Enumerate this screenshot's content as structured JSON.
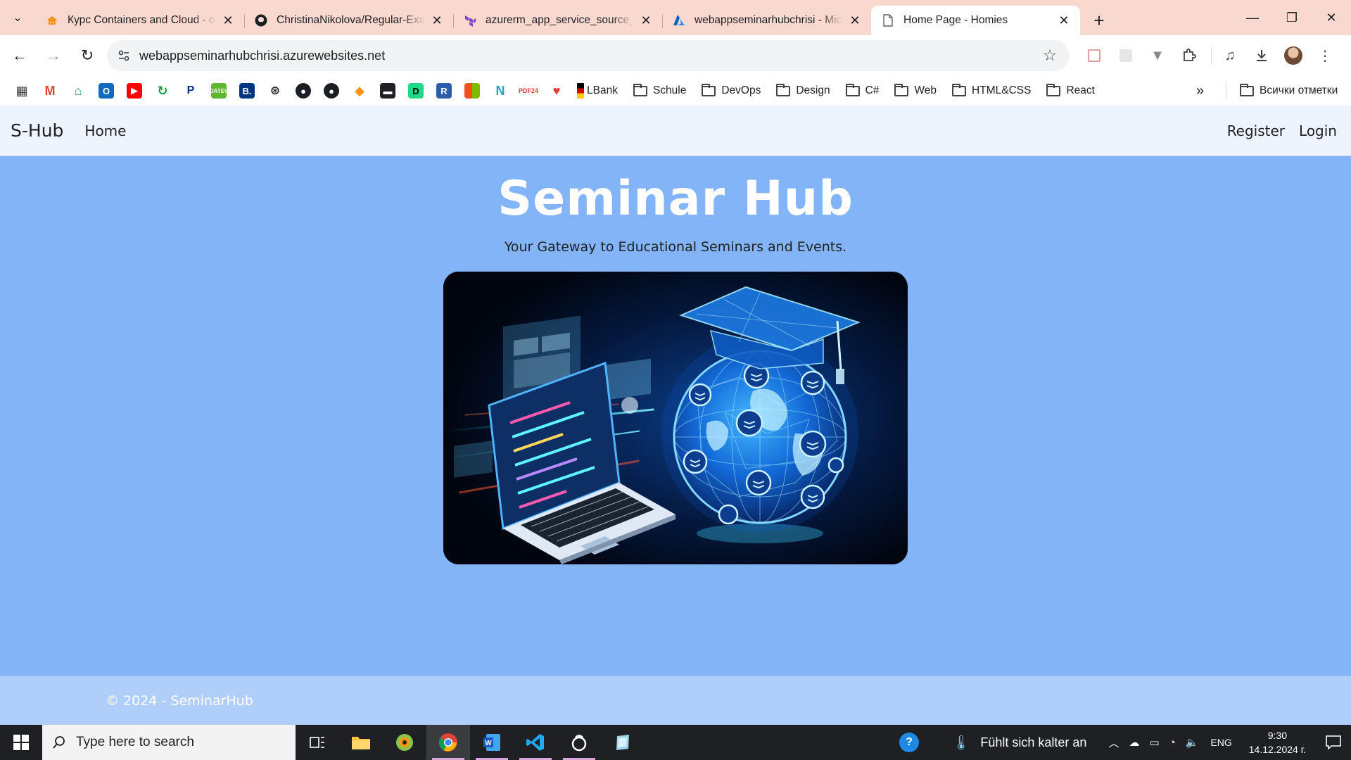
{
  "browser": {
    "tabs": [
      {
        "title": "Курс Containers and Cloud - ok",
        "icon": "moodle-icon"
      },
      {
        "title": "ChristinaNikolova/Regular-Exam",
        "icon": "github-icon"
      },
      {
        "title": "azurerm_app_service_source_co",
        "icon": "terraform-icon"
      },
      {
        "title": "webappseminarhubchrisi - Micr",
        "icon": "azure-icon"
      },
      {
        "title": "Home Page - Homies",
        "icon": "document-icon",
        "active": true
      }
    ],
    "url": "webappseminarhubchrisi.azurewebsites.net",
    "bookmark_folders": [
      "LBank",
      "Schule",
      "DevOps",
      "Design",
      "C#",
      "Web",
      "HTML&CSS",
      "React"
    ],
    "all_bookmarks_label": "Всички отметки"
  },
  "site": {
    "brand": "S-Hub",
    "nav": {
      "home": "Home",
      "register": "Register",
      "login": "Login"
    },
    "hero": {
      "title": "Seminar Hub",
      "subtitle": "Your Gateway to Educational Seminars and Events."
    },
    "footer": "© 2024 - SeminarHub",
    "colors": {
      "page_bg": "#84b4f8",
      "nav_bg": "#eef4fd",
      "footer_bg": "#b0cefa"
    }
  },
  "taskbar": {
    "search_placeholder": "Type here to search",
    "weather": "Fühlt sich kalter an",
    "lang": "ENG",
    "time": "9:30",
    "date": "14.12.2024 г."
  }
}
